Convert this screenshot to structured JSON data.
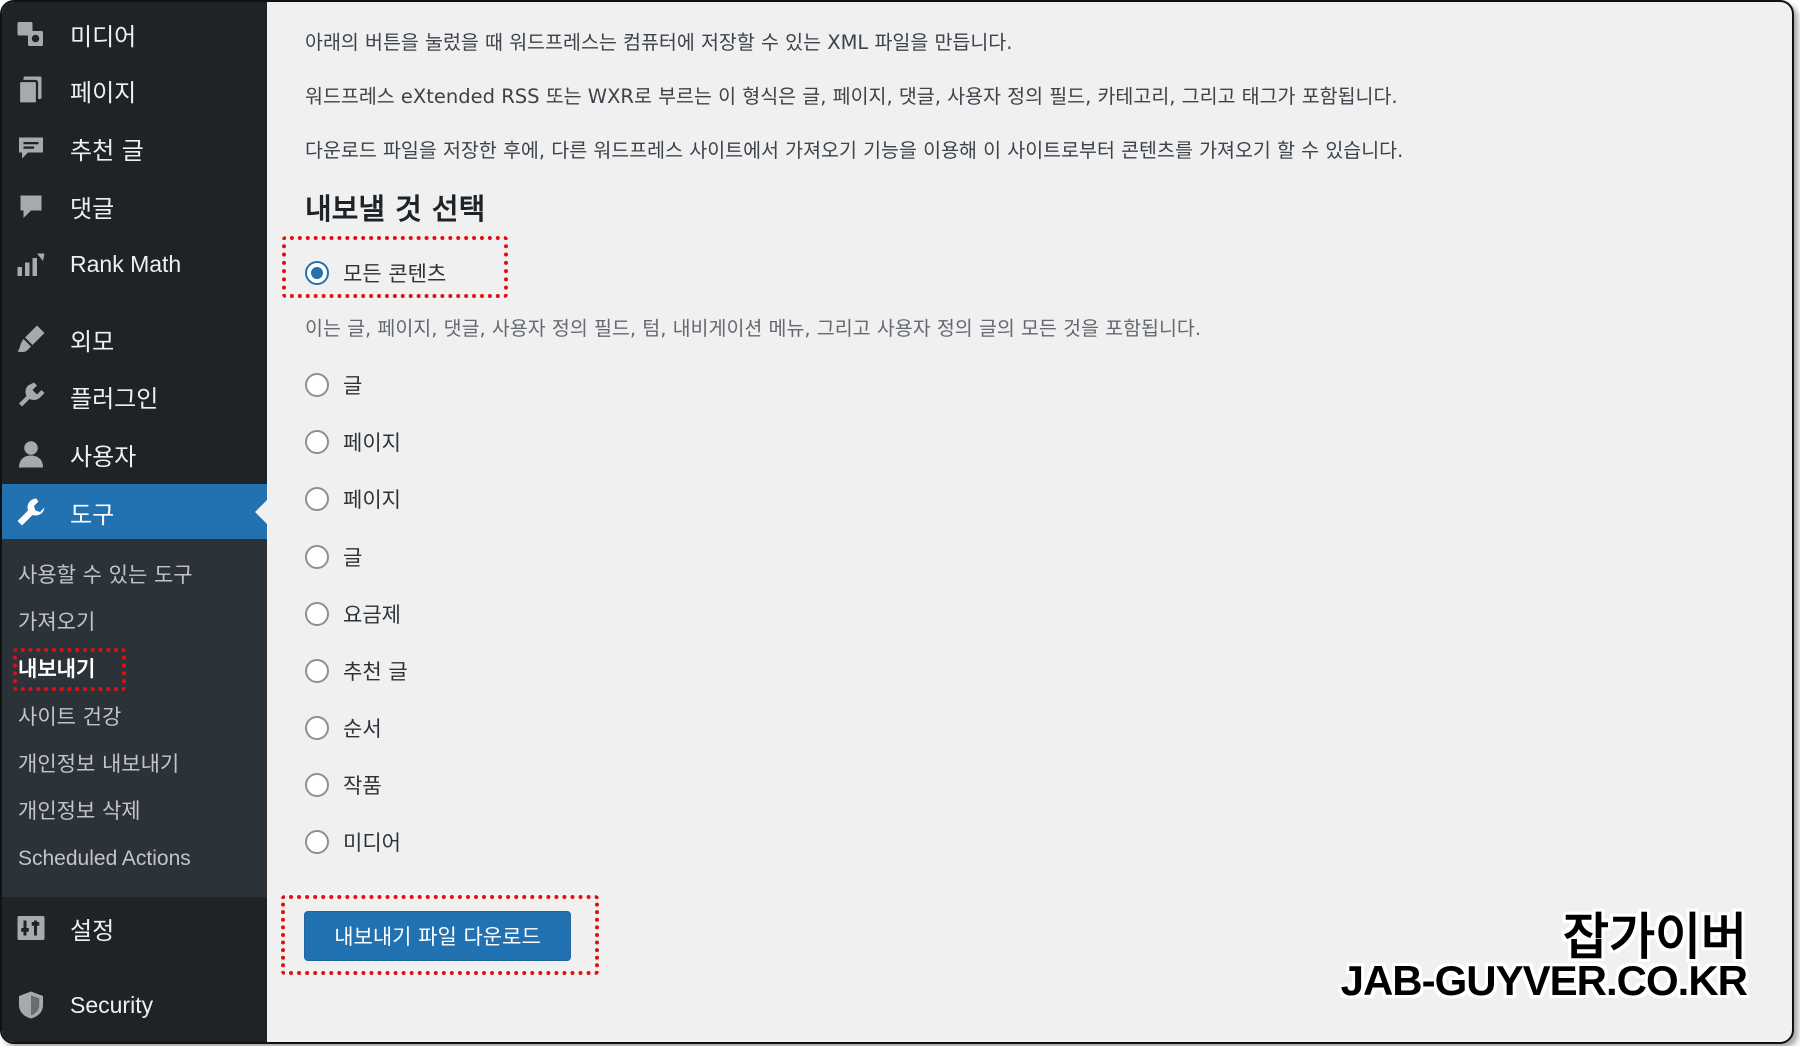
{
  "sidebar": {
    "items": [
      {
        "label": "미디어",
        "icon": "media-icon"
      },
      {
        "label": "페이지",
        "icon": "page-icon"
      },
      {
        "label": "추천 글",
        "icon": "testimonial-icon"
      },
      {
        "label": "댓글",
        "icon": "comment-icon"
      },
      {
        "label": "Rank Math",
        "icon": "rank-math-icon"
      },
      {
        "label": "외모",
        "icon": "appearance-brush-icon"
      },
      {
        "label": "플러그인",
        "icon": "plugin-icon"
      },
      {
        "label": "사용자",
        "icon": "user-icon"
      },
      {
        "label": "도구",
        "icon": "wrench-icon",
        "active": true
      },
      {
        "label": "설정",
        "icon": "settings-icon"
      },
      {
        "label": "Security",
        "icon": "shield-icon"
      }
    ],
    "submenu": [
      {
        "label": "사용할 수 있는 도구"
      },
      {
        "label": "가져오기"
      },
      {
        "label": "내보내기",
        "current": true
      },
      {
        "label": "사이트 건강"
      },
      {
        "label": "개인정보 내보내기"
      },
      {
        "label": "개인정보 삭제"
      },
      {
        "label": "Scheduled Actions"
      }
    ]
  },
  "main": {
    "intro": [
      "아래의 버튼을 눌렀을 때 워드프레스는 컴퓨터에 저장할 수 있는 XML 파일을 만듭니다.",
      "워드프레스 eXtended RSS 또는 WXR로 부르는 이 형식은 글, 페이지, 댓글, 사용자 정의 필드, 카테고리, 그리고 태그가 포함됩니다.",
      "다운로드 파일을 저장한 후에, 다른 워드프레스 사이트에서 가져오기 기능을 이용해 이 사이트로부터 콘텐츠를 가져오기 할 수 있습니다."
    ],
    "section_title": "내보낼 것 선택",
    "all_content_label": "모든 콘텐츠",
    "all_content_desc": "이는 글, 페이지, 댓글, 사용자 정의 필드, 텀, 내비게이션 메뉴, 그리고 사용자 정의 글의 모든 것을 포함됩니다.",
    "options": [
      "글",
      "페이지",
      "페이지",
      "글",
      "요금제",
      "추천 글",
      "순서",
      "작품",
      "미디어"
    ],
    "download_button": "내보내기 파일 다운로드"
  },
  "watermark": {
    "korean": "잡가이버",
    "url": "JAB-GUYVER.CO.KR"
  },
  "colors": {
    "sidebar_bg": "#1d2327",
    "submenu_bg": "#2c3338",
    "accent": "#2271b1",
    "highlight_box": "#e01010",
    "content_bg": "#f0f0f1"
  }
}
